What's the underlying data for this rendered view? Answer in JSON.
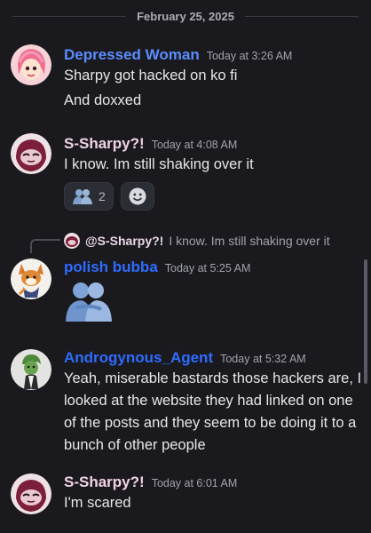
{
  "date_divider": "February 25, 2025",
  "messages": [
    {
      "author": "Depressed Woman",
      "author_color": "#5b8cff",
      "timestamp": "Today at 3:26 AM",
      "lines": [
        "Sharpy got hacked on ko fi",
        "And doxxed"
      ]
    },
    {
      "author": "S-Sharpy?!",
      "author_color": "#f2d3e6",
      "timestamp": "Today at 4:08 AM",
      "lines": [
        "I know. Im still shaking over it"
      ],
      "reactions": [
        {
          "icon": "hug-emoji-icon",
          "count": "2"
        },
        {
          "icon": "add-reaction-icon"
        }
      ]
    },
    {
      "reply": {
        "author": "@S-Sharpy?!",
        "text": "I know. Im still shaking over it"
      },
      "author": "polish bubba",
      "author_color": "#2f6bff",
      "timestamp": "Today at 5:25 AM",
      "sticker": "hug-sticker"
    },
    {
      "author": "Androgynous_Agent",
      "author_color": "#2f6bff",
      "timestamp": "Today at 5:32 AM",
      "text": "Yeah, miserable bastards those hackers are, I looked at the website they had linked on one of the posts and they seem to be doing it to a bunch of other people"
    },
    {
      "author": "S-Sharpy?!",
      "author_color": "#f2d3e6",
      "timestamp": "Today at 6:01 AM",
      "lines": [
        "I'm scared"
      ]
    }
  ]
}
